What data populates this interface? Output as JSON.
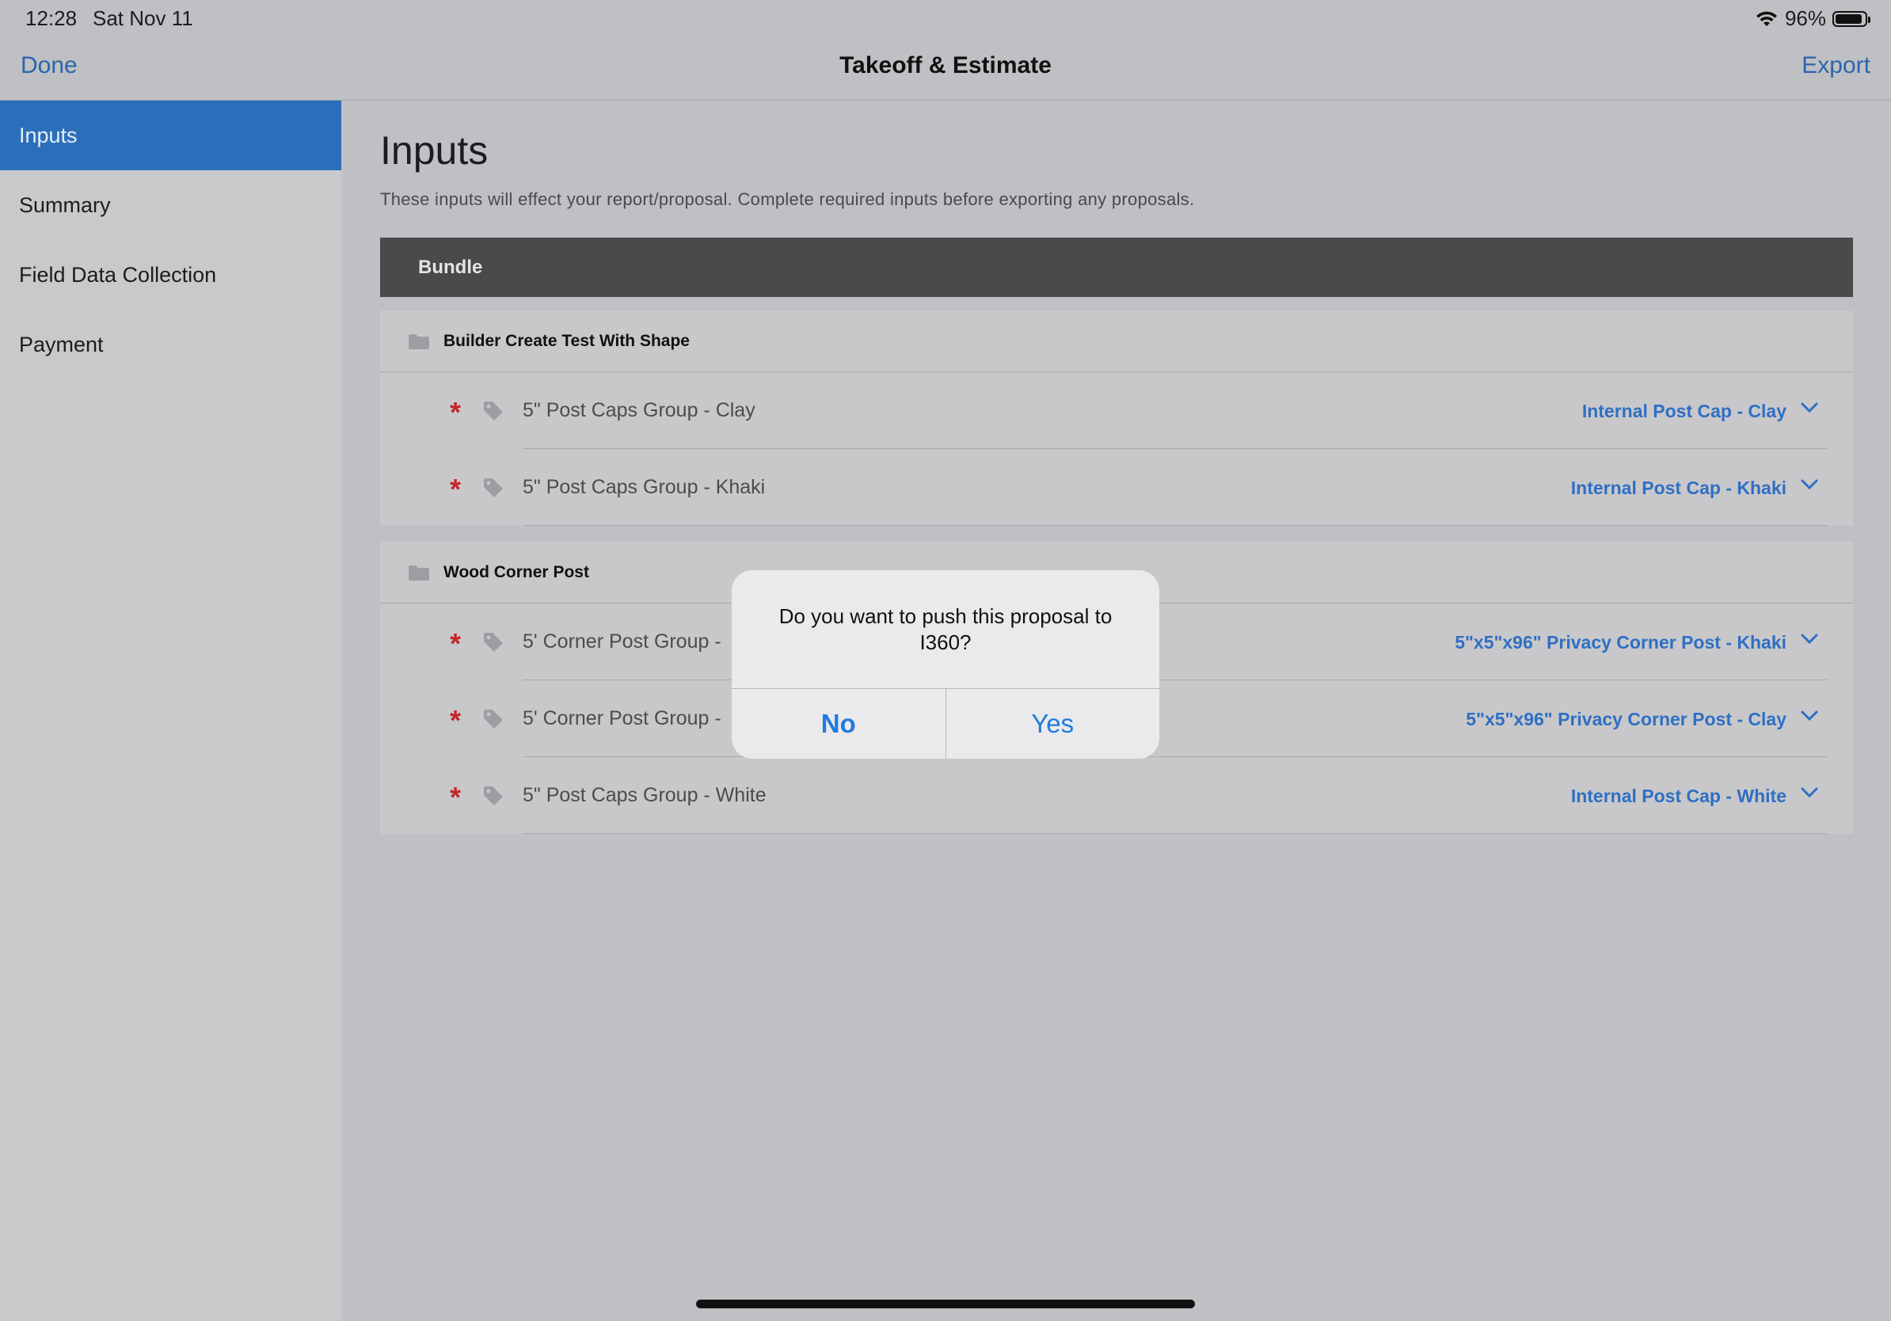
{
  "status_bar": {
    "time": "12:28",
    "date": "Sat Nov 11",
    "battery": "96%"
  },
  "nav": {
    "done": "Done",
    "title": "Takeoff & Estimate",
    "export": "Export"
  },
  "sidebar": {
    "items": [
      {
        "label": "Inputs"
      },
      {
        "label": "Summary"
      },
      {
        "label": "Field Data Collection"
      },
      {
        "label": "Payment"
      }
    ]
  },
  "main": {
    "title": "Inputs",
    "description": "These inputs will effect your report/proposal. Complete required inputs before exporting any proposals.",
    "bundle": "Bundle",
    "groups": [
      {
        "title": "Builder Create Test With Shape",
        "rows": [
          {
            "required": "*",
            "label": "5\" Post Caps Group - Clay",
            "value": "Internal Post Cap - Clay"
          },
          {
            "required": "*",
            "label": "5\" Post Caps Group - Khaki",
            "value": "Internal Post Cap - Khaki"
          }
        ]
      },
      {
        "title": "Wood Corner Post",
        "rows": [
          {
            "required": "*",
            "label": "5' Corner Post Group -",
            "value": "5\"x5\"x96\" Privacy Corner Post - Khaki"
          },
          {
            "required": "*",
            "label": "5' Corner Post Group -",
            "value": "5\"x5\"x96\" Privacy Corner Post - Clay"
          },
          {
            "required": "*",
            "label": "5\" Post Caps Group - White",
            "value": "Internal Post Cap - White"
          }
        ]
      }
    ]
  },
  "alert": {
    "message": "Do you want to push this proposal to I360?",
    "no": "No",
    "yes": "Yes"
  },
  "colors": {
    "accent": "#2b6fba",
    "link": "#2f6fc4",
    "required": "#c4262c",
    "bundle_bar": "#4a4a4a"
  },
  "icons": {
    "folder": "folder-icon",
    "tag": "tag-icon",
    "chevron": "chevron-down-icon",
    "wifi": "wifi-icon",
    "battery": "battery-icon"
  }
}
